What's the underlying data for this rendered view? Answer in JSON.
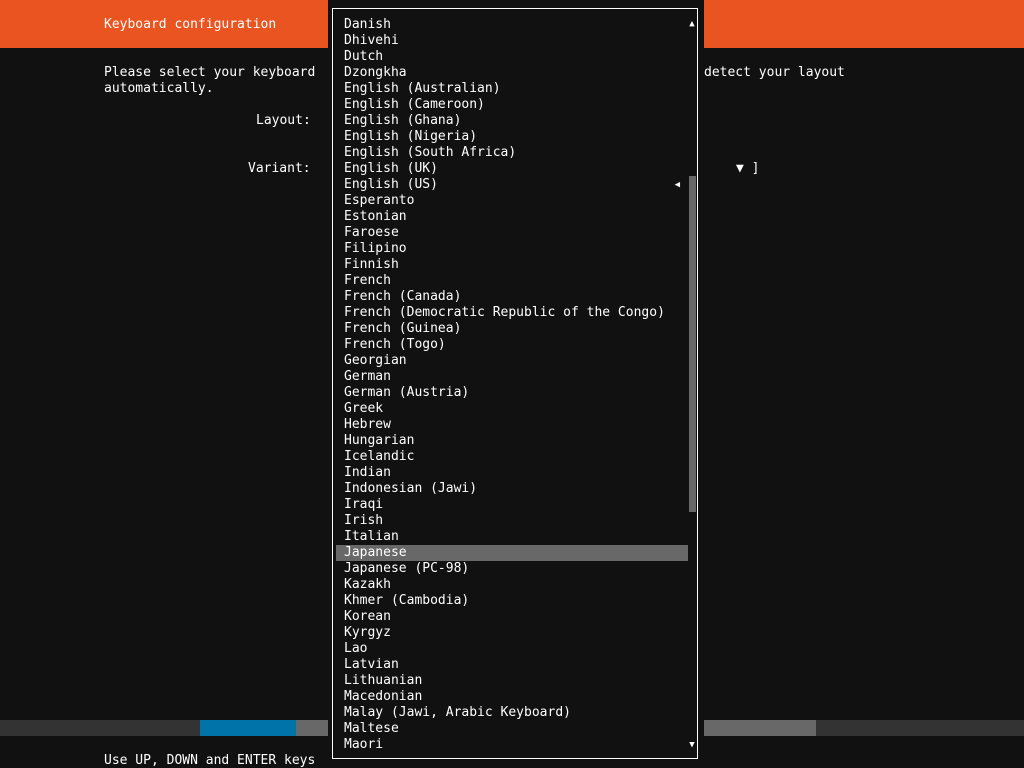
{
  "header": {
    "title": "Keyboard configuration"
  },
  "intro": {
    "line1_left": "Please select your keyboard",
    "line1_right": "detect your layout",
    "line2": "automatically."
  },
  "form": {
    "layout_label": "Layout:",
    "variant_label": "Variant:",
    "variant_tail": "▼ ]"
  },
  "progress": {
    "fraction": 0.156
  },
  "footer": {
    "hint": "Use UP, DOWN and ENTER keys"
  },
  "dropdown": {
    "scroll_up_icon": "▲",
    "scroll_down_icon": "▼",
    "current_marker": "◀",
    "options": [
      "Danish",
      "Dhivehi",
      "Dutch",
      "Dzongkha",
      "English (Australian)",
      "English (Cameroon)",
      "English (Ghana)",
      "English (Nigeria)",
      "English (South Africa)",
      "English (UK)",
      "English (US)",
      "Esperanto",
      "Estonian",
      "Faroese",
      "Filipino",
      "Finnish",
      "French",
      "French (Canada)",
      "French (Democratic Republic of the Congo)",
      "French (Guinea)",
      "French (Togo)",
      "Georgian",
      "German",
      "German (Austria)",
      "Greek",
      "Hebrew",
      "Hungarian",
      "Icelandic",
      "Indian",
      "Indonesian (Jawi)",
      "Iraqi",
      "Irish",
      "Italian",
      "Japanese",
      "Japanese (PC-98)",
      "Kazakh",
      "Khmer (Cambodia)",
      "Korean",
      "Kyrgyz",
      "Lao",
      "Latvian",
      "Lithuanian",
      "Macedonian",
      "Malay (Jawi, Arabic Keyboard)",
      "Maltese",
      "Maori"
    ],
    "selected": "Japanese",
    "current": "English (US)"
  },
  "colors": {
    "accent": "#e95420",
    "background": "#111111",
    "highlight": "#686868",
    "progress_fill": "#0073a8"
  }
}
